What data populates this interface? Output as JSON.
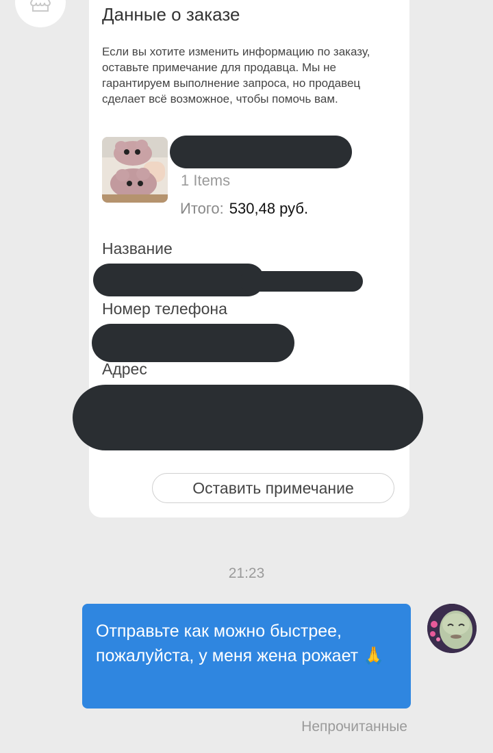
{
  "order_card": {
    "title": "Данные о заказе",
    "description": "Если вы хотите изменить информацию по заказу, оставьте примечание для продавца. Мы не гарантируем выполнение запроса, но продавец сделает всё возможное, чтобы помочь вам.",
    "items_count": "1 Items",
    "total_label": "Итого:",
    "total_value": "530,48 руб.",
    "name_label": "Название",
    "phone_label": "Номер телефона",
    "address_label": "Адрес",
    "note_button": "Оставить примечание"
  },
  "chat": {
    "timestamp": "21:23",
    "message_text": "Отправьте как можно быстрее, пожалуйста, у меня жена рожает 🙏",
    "status": "Непрочитанные"
  },
  "colors": {
    "bubble": "#2f86e0",
    "background": "#ebebeb",
    "redaction": "#2a2e32"
  },
  "icons": {
    "shop_avatar": "shop-icon",
    "product_image": "plush-gloves-image",
    "user_avatar": "user-avatar-image"
  }
}
